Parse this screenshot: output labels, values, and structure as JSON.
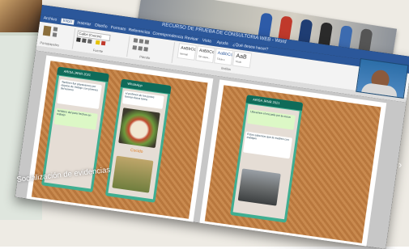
{
  "word": {
    "window_title": "RECURSO DE PRUEBA DE CONSULTORIA WEB - Word",
    "tabs": [
      "Archivo",
      "Inicio",
      "Insertar",
      "Diseño",
      "Formato",
      "Referencias",
      "Correspondencia",
      "Revisar",
      "Vista",
      "Ayuda",
      "¿Qué desea hacer?"
    ],
    "active_tab": "Inicio",
    "font_name": "Calibri (Cuerpo)",
    "groups": [
      "Portapapeles",
      "Fuente",
      "Párrafo",
      "Estilos"
    ],
    "styles": [
      {
        "sample": "AaBbCc",
        "name": "Normal"
      },
      {
        "sample": "AaBbCc",
        "name": "Sin espa..."
      },
      {
        "sample": "AaBbCc",
        "name": "Título 1"
      },
      {
        "sample": "AaB",
        "name": "Título"
      }
    ]
  },
  "chats": [
    {
      "title": "ARISA JRNR 2021",
      "messages": [
        "Tambien fue planteamos por objetos de trabajo con jóvenes del terreno",
        "tambien del para hechos en trabajo"
      ]
    },
    {
      "title": "WhatsApp",
      "messages": [
        "el profesor de los juntos forman fuera tarea"
      ]
    },
    {
      "title": "ARISA JRNR 2021",
      "messages": [
        "Ubicamos el escuela por la mesa",
        "Estos sabemos que la madres con trabajan"
      ]
    }
  ],
  "photo_captions": [
    "Cocido"
  ],
  "caption": "Socialización de evidencias",
  "colors": {
    "word_blue": "#2b579a",
    "whatsapp_green": "#0f6b59",
    "cork": "#c98a4f"
  }
}
